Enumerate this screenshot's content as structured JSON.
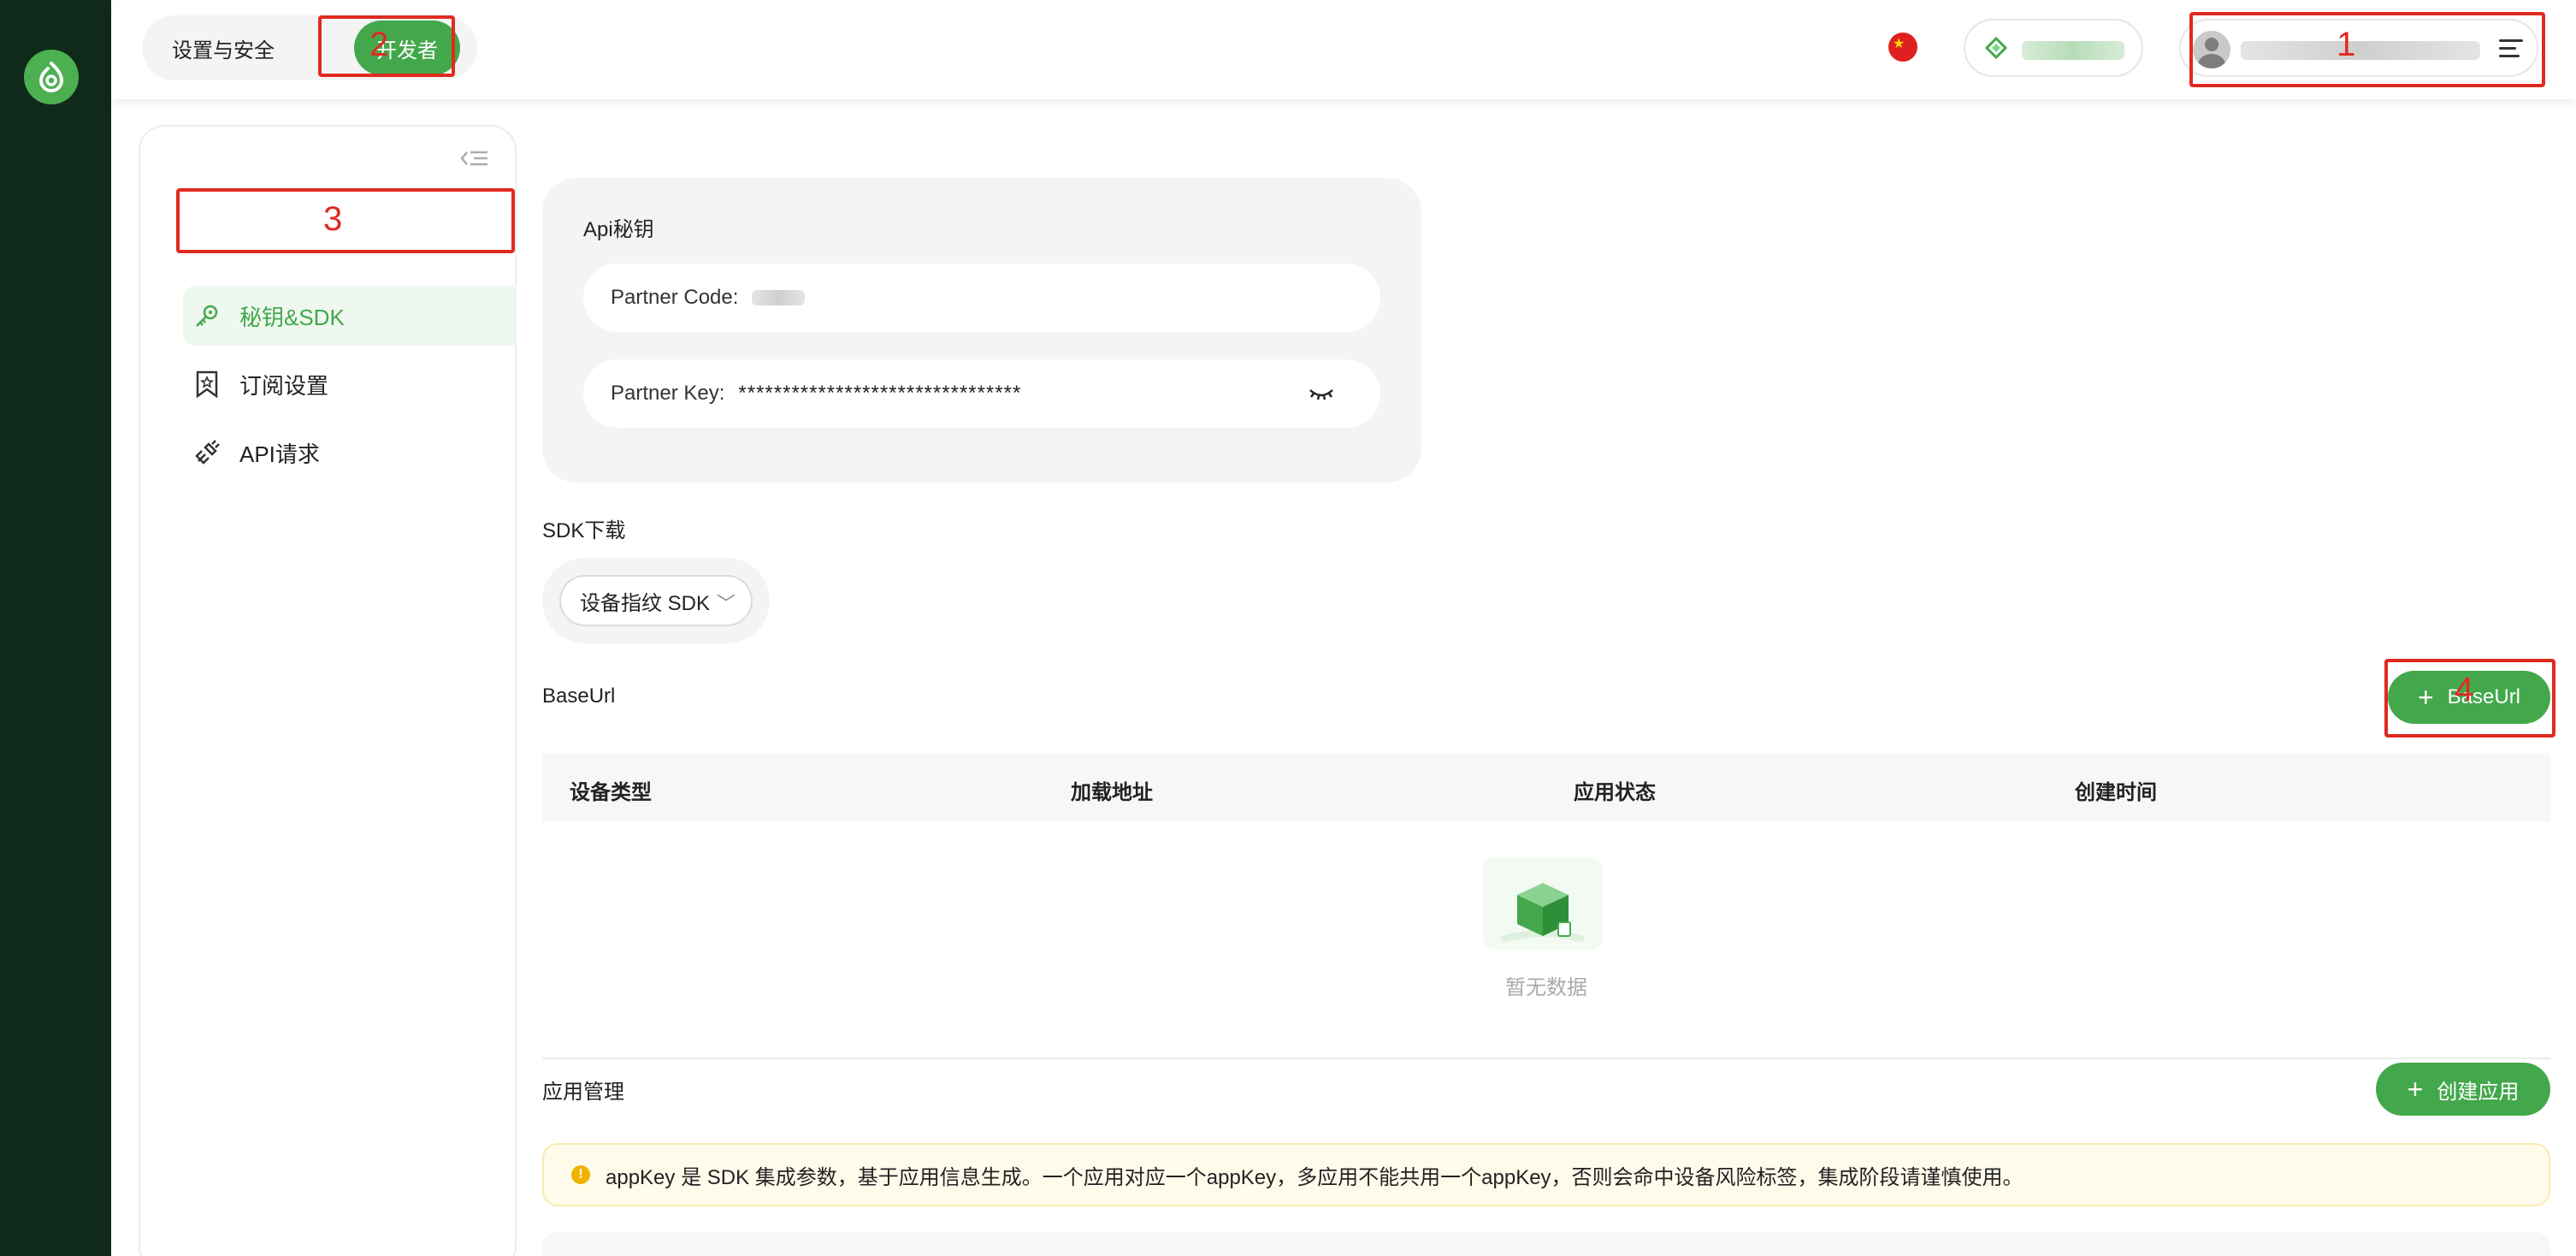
{
  "colors": {
    "brand_green": "#43a84b",
    "rail_dark": "#0f2a1b",
    "annotation_red": "#e02a20"
  },
  "header": {
    "tabs": [
      {
        "label": "设置与安全"
      },
      {
        "label": "开发者"
      }
    ],
    "flag_icon": "cn-flag-icon",
    "vip_icon": "diamond-icon",
    "menu_icon": "menu-icon"
  },
  "annotations": {
    "n1": "1",
    "n2": "2",
    "n3": "3",
    "n4": "4"
  },
  "sidebar": {
    "items": [
      {
        "label": "秘钥&SDK",
        "icon": "key-icon"
      },
      {
        "label": "订阅设置",
        "icon": "bookmark-icon"
      },
      {
        "label": "API请求",
        "icon": "plug-icon"
      }
    ]
  },
  "api_keys": {
    "title": "Api秘钥",
    "partner_code_label": "Partner Code:",
    "partner_key_label": "Partner Key:",
    "partner_key_value": "********************************"
  },
  "sdk": {
    "title": "SDK下载",
    "select_value": "设备指纹 SDK"
  },
  "baseurl": {
    "title": "BaseUrl",
    "add_button": "BaseUrl",
    "columns": [
      "设备类型",
      "加载地址",
      "应用状态",
      "创建时间"
    ],
    "empty_text": "暂无数据"
  },
  "apps": {
    "title": "应用管理",
    "create_button": "创建应用",
    "notice": "appKey 是 SDK 集成参数，基于应用信息生成。一个应用对应一个appKey，多应用不能共用一个appKey，否则会命中设备风险标签，集成阶段请谨慎使用。"
  }
}
